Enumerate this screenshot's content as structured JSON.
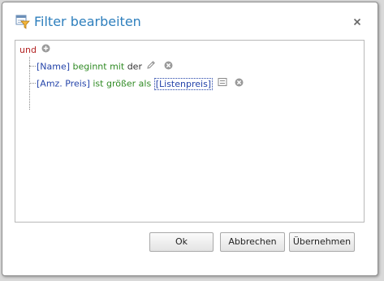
{
  "dialog": {
    "title": "Filter bearbeiten",
    "title_icon": "filter-edit-icon",
    "close_icon": "close-icon"
  },
  "filter": {
    "group_operator": "und",
    "add_icon": "add-condition-icon",
    "conditions": [
      {
        "field": "[Name]",
        "operator": "beginnt mit",
        "value": "der",
        "edit_icon": "pencil-icon",
        "remove_icon": "remove-condition-icon"
      },
      {
        "field": "[Amz. Preis]",
        "operator": "ist größer als",
        "value": "[Listenpreis]",
        "value_type_icon": "field-value-icon",
        "remove_icon": "remove-condition-icon"
      }
    ]
  },
  "buttons": {
    "ok": "Ok",
    "cancel": "Abbrechen",
    "apply": "Übernehmen"
  },
  "colors": {
    "title": "#2e7fbd",
    "group_operator": "#b22222",
    "field": "#2343a9",
    "operator": "#2f8a23",
    "value": "#333333"
  }
}
